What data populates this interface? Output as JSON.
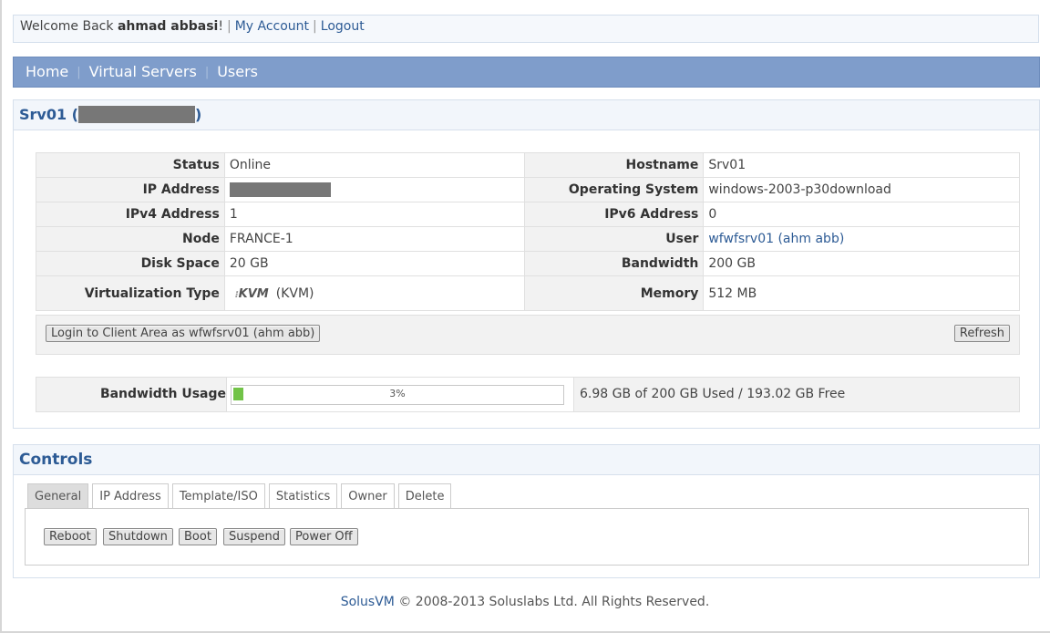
{
  "topbar": {
    "welcome": "Welcome Back",
    "username": "ahmad abbasi",
    "exclaim": "!",
    "my_account": "My Account",
    "logout": "Logout"
  },
  "nav": [
    "Home",
    "Virtual Servers",
    "Users"
  ],
  "server": {
    "title_prefix": "Srv01 (",
    "title_suffix": ")"
  },
  "details": {
    "status_label": "Status",
    "status_value": "Online",
    "hostname_label": "Hostname",
    "hostname_value": "Srv01",
    "ip_label": "IP Address",
    "os_label": "Operating System",
    "os_value": "windows-2003-p30download",
    "ipv4_label": "IPv4 Address",
    "ipv4_value": "1",
    "ipv6_label": "IPv6 Address",
    "ipv6_value": "0",
    "node_label": "Node",
    "node_value": "FRANCE-1",
    "user_label": "User",
    "user_value": "wfwfsrv01 (ahm abb)",
    "disk_label": "Disk Space",
    "disk_value": "20 GB",
    "bandwidth_label": "Bandwidth",
    "bandwidth_value": "200 GB",
    "virt_label": "Virtualization Type",
    "virt_logo": "KVM",
    "virt_value": "(KVM)",
    "memory_label": "Memory",
    "memory_value": "512 MB"
  },
  "actions": {
    "login_client": "Login to Client Area as wfwfsrv01 (ahm abb)",
    "refresh": "Refresh"
  },
  "bandwidth_usage": {
    "label": "Bandwidth Usage",
    "percent": 3,
    "percent_text": "3%",
    "summary": "6.98 GB of 200 GB Used / 193.02 GB Free"
  },
  "controls": {
    "title": "Controls",
    "tabs": [
      "General",
      "IP Address",
      "Template/ISO",
      "Statistics",
      "Owner",
      "Delete"
    ],
    "active_tab": "General",
    "buttons": [
      "Reboot",
      "Shutdown",
      "Boot",
      "Suspend",
      "Power Off"
    ]
  },
  "footer": {
    "brand": "SolusVM",
    "text": " © 2008-2013 Soluslabs Ltd. All Rights Reserved."
  },
  "colors": {
    "nav_bg": "#7f9dcb",
    "link": "#2d5b95",
    "online": "#2a9a2a",
    "progress": "#72c348"
  }
}
